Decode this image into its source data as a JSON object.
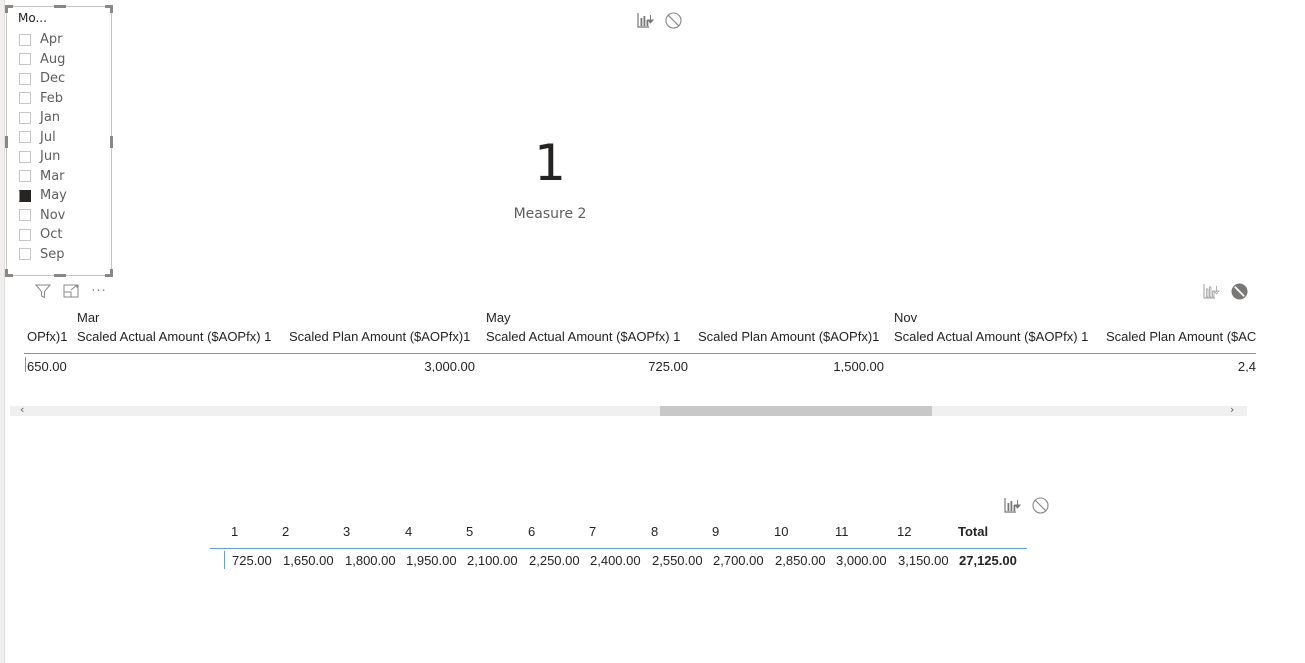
{
  "slicer": {
    "title": "Mo...",
    "items": [
      {
        "label": "Apr",
        "checked": false
      },
      {
        "label": "Aug",
        "checked": false
      },
      {
        "label": "Dec",
        "checked": false
      },
      {
        "label": "Feb",
        "checked": false
      },
      {
        "label": "Jan",
        "checked": false
      },
      {
        "label": "Jul",
        "checked": false
      },
      {
        "label": "Jun",
        "checked": false
      },
      {
        "label": "Mar",
        "checked": false
      },
      {
        "label": "May",
        "checked": true
      },
      {
        "label": "Nov",
        "checked": false
      },
      {
        "label": "Oct",
        "checked": false
      },
      {
        "label": "Sep",
        "checked": false
      }
    ],
    "toolbar": [
      "filter-icon",
      "focus-mode-icon",
      "more-options-icon"
    ],
    "more_label": "···"
  },
  "card": {
    "value": "1",
    "label": "Measure 2"
  },
  "matrix1": {
    "groups": [
      "Mar",
      "May",
      "Nov"
    ],
    "columns": [
      "OPfx)1",
      "Scaled Actual Amount ($AOPfx) 1",
      "Scaled Plan Amount ($AOPfx)1",
      "Scaled Actual Amount ($AOPfx) 1",
      "Scaled Plan Amount ($AOPfx)1",
      "Scaled Actual Amount ($AOPfx) 1",
      "Scaled Plan Amount ($AC"
    ],
    "row": [
      "650.00",
      "",
      "3,000.00",
      "725.00",
      "1,500.00",
      "",
      "2,4"
    ],
    "scroll_left": "‹",
    "scroll_right": "›"
  },
  "matrix2": {
    "columns": [
      "1",
      "2",
      "3",
      "4",
      "5",
      "6",
      "7",
      "8",
      "9",
      "10",
      "11",
      "12",
      "Total"
    ],
    "values": [
      "725.00",
      "1,650.00",
      "1,800.00",
      "1,950.00",
      "2,100.00",
      "2,250.00",
      "2,400.00",
      "2,550.00",
      "2,700.00",
      "2,850.00",
      "3,000.00",
      "3,150.00",
      "27,125.00"
    ]
  },
  "colors": {
    "accent_line": "#5ea0d9",
    "text": "#252423",
    "muted": "#605e5c",
    "checked_box": "#252423"
  }
}
